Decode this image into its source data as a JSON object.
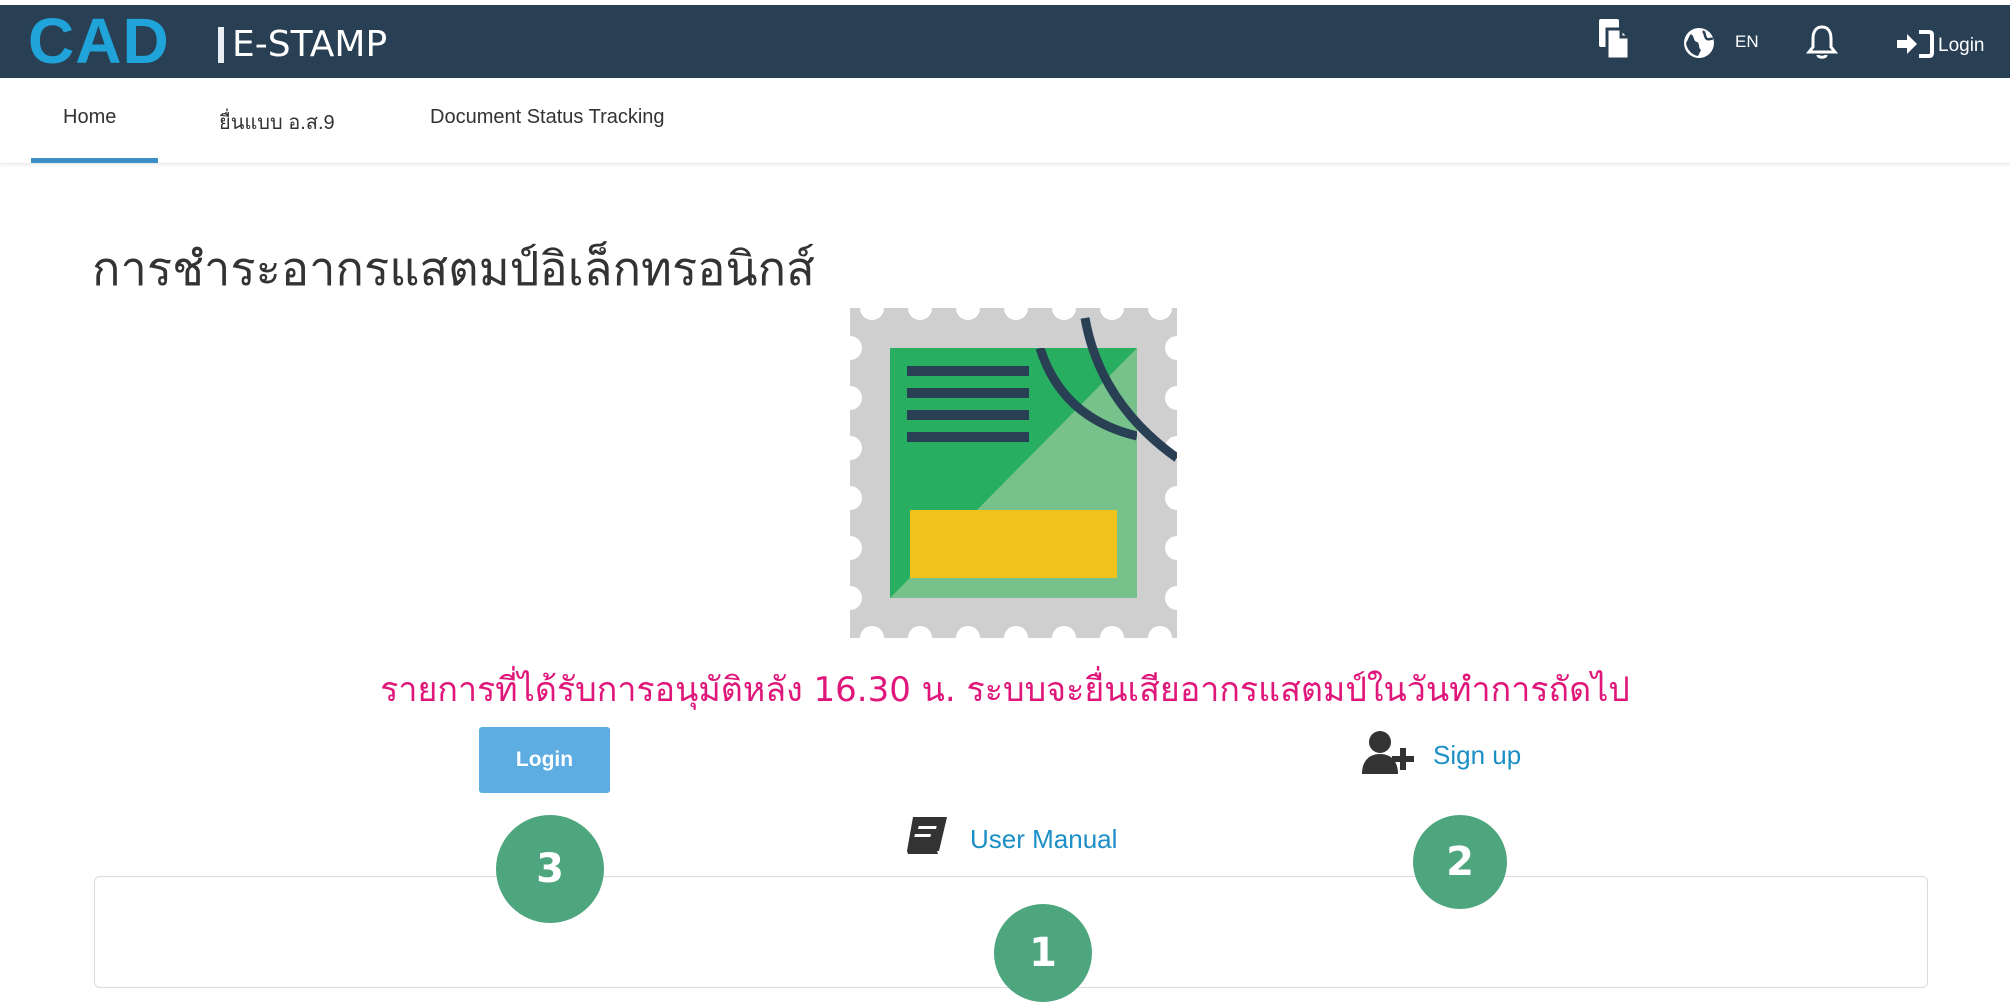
{
  "header": {
    "logo": "CAD",
    "product": "E-STAMP",
    "lang": "EN",
    "login": "Login",
    "icons": [
      "document-icon",
      "globe-icon",
      "bell-icon",
      "sign-in-icon"
    ]
  },
  "nav": {
    "tabs": [
      {
        "label": "Home",
        "active": true
      },
      {
        "label": "ยื่นแบบ อ.ส.9",
        "active": false
      },
      {
        "label": "Document Status Tracking",
        "active": false
      }
    ]
  },
  "main": {
    "title": "การชำระอากรแสตมป์อิเล็กทรอนิกส์",
    "notice": "รายการที่ได้รับการอนุมัติหลัง 16.30 น. ระบบจะยื่นเสียอากรแสตมป์ในวันทำการถัดไป",
    "login_button": "Login",
    "signup_link": "Sign up",
    "manual_link": "User Manual"
  },
  "annotations": {
    "marker_1": "1",
    "marker_2": "2",
    "marker_3": "3"
  },
  "colors": {
    "header_bg": "#283f54",
    "logo": "#1fa3d8",
    "accent": "#3f8fc7",
    "notice": "#e0177b",
    "link": "#1b8fc6",
    "button": "#5dade2",
    "marker": "#4ea67e"
  }
}
